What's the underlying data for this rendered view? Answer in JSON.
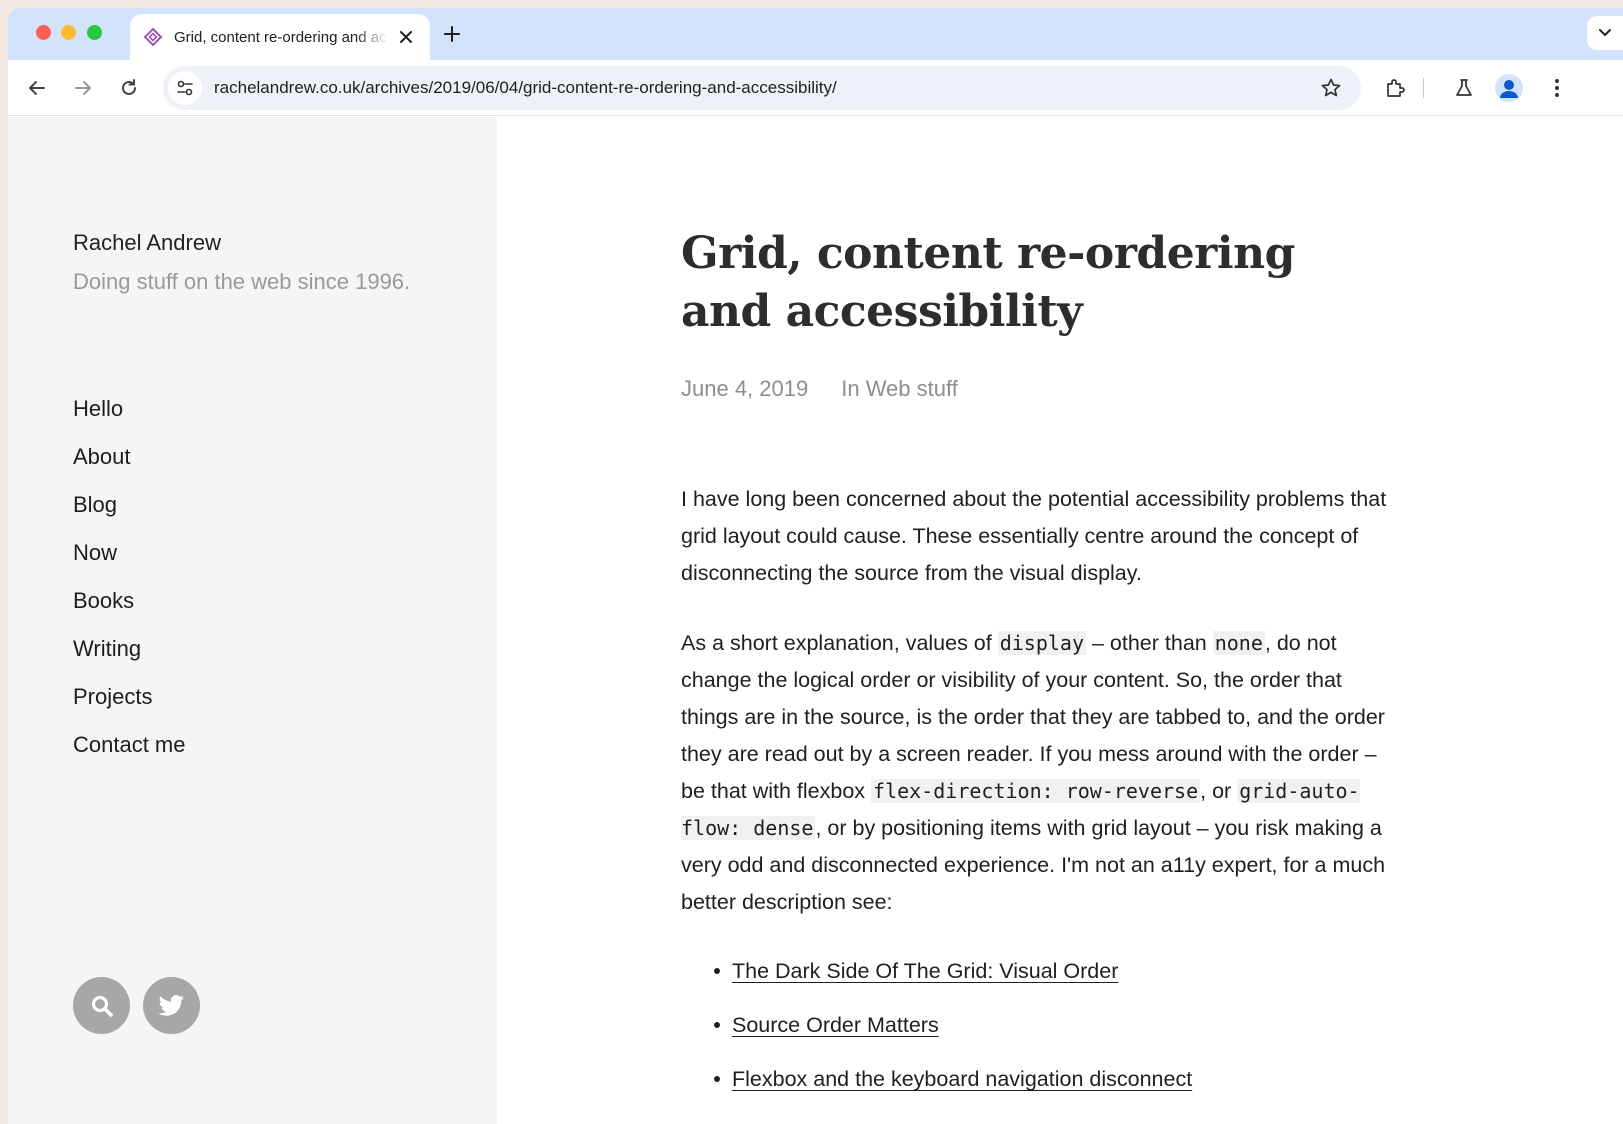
{
  "browser": {
    "tab_title": "Grid, content re-ordering and accessibility",
    "url_host": "rachelandrew.co.uk",
    "url_path": "/archives/2019/06/04/grid-content-re-ordering-and-accessibility/",
    "icons": [
      "back-icon",
      "forward-icon",
      "reload-icon",
      "site-info-icon",
      "star-icon",
      "extensions-icon",
      "labs-icon",
      "profile-icon",
      "more-icon",
      "close-icon",
      "plus-icon",
      "chevron-down-icon"
    ]
  },
  "sidebar": {
    "site_title": "Rachel Andrew",
    "tagline": "Doing stuff on the web since 1996.",
    "nav": [
      "Hello",
      "About",
      "Blog",
      "Now",
      "Books",
      "Writing",
      "Projects",
      "Contact me"
    ],
    "social_icons": [
      "search-icon",
      "twitter-icon"
    ]
  },
  "post": {
    "title": "Grid, content re-ordering and accessibility",
    "date": "June 4, 2019",
    "category": "In Web stuff",
    "p1": "I have long been concerned about the potential accessibility problems that grid layout could cause. These essentially centre around the concept of disconnecting the source from the visual display.",
    "p2": {
      "t1": "As a short explanation, values of ",
      "c1": "display",
      "t2": " – other than ",
      "c2": "none",
      "t3": ", do not change the logical order or visibility of your content. So, the order that things are in the source, is the order that they are tabbed to, and the order they are read out by a screen reader. If you mess around with the order – be that with flexbox ",
      "c3": "flex-direction: row-reverse",
      "t4": ", or ",
      "c4": "grid-auto-flow: dense",
      "t5": ", or by positioning items with grid layout – you risk making a very odd and disconnected experience. I'm not an a11y expert, for a much better description see:"
    },
    "links": [
      "The Dark Side Of The Grid: Visual Order",
      "Source Order Matters",
      "Flexbox and the keyboard navigation disconnect"
    ]
  },
  "colors": {
    "tabstrip": "#d3e3fd",
    "sidebar_bg": "#f4f5f7",
    "tagline": "#9a9a9a",
    "meta": "#8e8e8e",
    "social_bg": "#a7a7a7"
  }
}
